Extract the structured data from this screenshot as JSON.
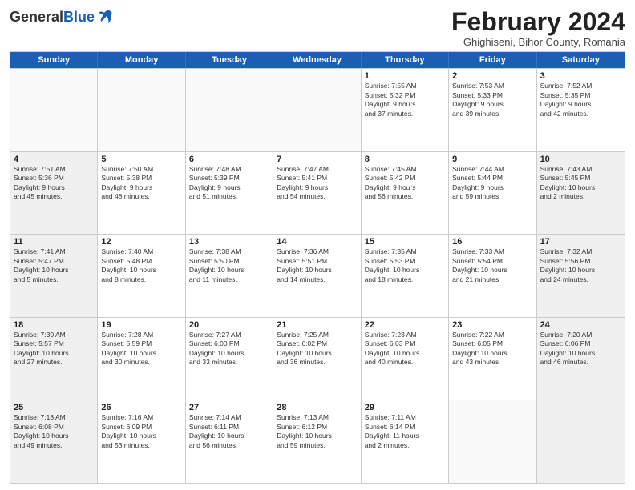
{
  "header": {
    "logo_general": "General",
    "logo_blue": "Blue",
    "month_title": "February 2024",
    "location": "Ghighiseni, Bihor County, Romania"
  },
  "days_of_week": [
    "Sunday",
    "Monday",
    "Tuesday",
    "Wednesday",
    "Thursday",
    "Friday",
    "Saturday"
  ],
  "rows": [
    [
      {
        "day": "",
        "empty": true,
        "lines": []
      },
      {
        "day": "",
        "empty": true,
        "lines": []
      },
      {
        "day": "",
        "empty": true,
        "lines": []
      },
      {
        "day": "",
        "empty": true,
        "lines": []
      },
      {
        "day": "1",
        "lines": [
          "Sunrise: 7:55 AM",
          "Sunset: 5:32 PM",
          "Daylight: 9 hours",
          "and 37 minutes."
        ]
      },
      {
        "day": "2",
        "lines": [
          "Sunrise: 7:53 AM",
          "Sunset: 5:33 PM",
          "Daylight: 9 hours",
          "and 39 minutes."
        ]
      },
      {
        "day": "3",
        "lines": [
          "Sunrise: 7:52 AM",
          "Sunset: 5:35 PM",
          "Daylight: 9 hours",
          "and 42 minutes."
        ]
      }
    ],
    [
      {
        "day": "4",
        "shaded": true,
        "lines": [
          "Sunrise: 7:51 AM",
          "Sunset: 5:36 PM",
          "Daylight: 9 hours",
          "and 45 minutes."
        ]
      },
      {
        "day": "5",
        "lines": [
          "Sunrise: 7:50 AM",
          "Sunset: 5:38 PM",
          "Daylight: 9 hours",
          "and 48 minutes."
        ]
      },
      {
        "day": "6",
        "lines": [
          "Sunrise: 7:48 AM",
          "Sunset: 5:39 PM",
          "Daylight: 9 hours",
          "and 51 minutes."
        ]
      },
      {
        "day": "7",
        "lines": [
          "Sunrise: 7:47 AM",
          "Sunset: 5:41 PM",
          "Daylight: 9 hours",
          "and 54 minutes."
        ]
      },
      {
        "day": "8",
        "lines": [
          "Sunrise: 7:45 AM",
          "Sunset: 5:42 PM",
          "Daylight: 9 hours",
          "and 56 minutes."
        ]
      },
      {
        "day": "9",
        "lines": [
          "Sunrise: 7:44 AM",
          "Sunset: 5:44 PM",
          "Daylight: 9 hours",
          "and 59 minutes."
        ]
      },
      {
        "day": "10",
        "shaded": true,
        "lines": [
          "Sunrise: 7:43 AM",
          "Sunset: 5:45 PM",
          "Daylight: 10 hours",
          "and 2 minutes."
        ]
      }
    ],
    [
      {
        "day": "11",
        "shaded": true,
        "lines": [
          "Sunrise: 7:41 AM",
          "Sunset: 5:47 PM",
          "Daylight: 10 hours",
          "and 5 minutes."
        ]
      },
      {
        "day": "12",
        "lines": [
          "Sunrise: 7:40 AM",
          "Sunset: 5:48 PM",
          "Daylight: 10 hours",
          "and 8 minutes."
        ]
      },
      {
        "day": "13",
        "lines": [
          "Sunrise: 7:38 AM",
          "Sunset: 5:50 PM",
          "Daylight: 10 hours",
          "and 11 minutes."
        ]
      },
      {
        "day": "14",
        "lines": [
          "Sunrise: 7:36 AM",
          "Sunset: 5:51 PM",
          "Daylight: 10 hours",
          "and 14 minutes."
        ]
      },
      {
        "day": "15",
        "lines": [
          "Sunrise: 7:35 AM",
          "Sunset: 5:53 PM",
          "Daylight: 10 hours",
          "and 18 minutes."
        ]
      },
      {
        "day": "16",
        "lines": [
          "Sunrise: 7:33 AM",
          "Sunset: 5:54 PM",
          "Daylight: 10 hours",
          "and 21 minutes."
        ]
      },
      {
        "day": "17",
        "shaded": true,
        "lines": [
          "Sunrise: 7:32 AM",
          "Sunset: 5:56 PM",
          "Daylight: 10 hours",
          "and 24 minutes."
        ]
      }
    ],
    [
      {
        "day": "18",
        "shaded": true,
        "lines": [
          "Sunrise: 7:30 AM",
          "Sunset: 5:57 PM",
          "Daylight: 10 hours",
          "and 27 minutes."
        ]
      },
      {
        "day": "19",
        "lines": [
          "Sunrise: 7:28 AM",
          "Sunset: 5:59 PM",
          "Daylight: 10 hours",
          "and 30 minutes."
        ]
      },
      {
        "day": "20",
        "lines": [
          "Sunrise: 7:27 AM",
          "Sunset: 6:00 PM",
          "Daylight: 10 hours",
          "and 33 minutes."
        ]
      },
      {
        "day": "21",
        "lines": [
          "Sunrise: 7:25 AM",
          "Sunset: 6:02 PM",
          "Daylight: 10 hours",
          "and 36 minutes."
        ]
      },
      {
        "day": "22",
        "lines": [
          "Sunrise: 7:23 AM",
          "Sunset: 6:03 PM",
          "Daylight: 10 hours",
          "and 40 minutes."
        ]
      },
      {
        "day": "23",
        "lines": [
          "Sunrise: 7:22 AM",
          "Sunset: 6:05 PM",
          "Daylight: 10 hours",
          "and 43 minutes."
        ]
      },
      {
        "day": "24",
        "shaded": true,
        "lines": [
          "Sunrise: 7:20 AM",
          "Sunset: 6:06 PM",
          "Daylight: 10 hours",
          "and 46 minutes."
        ]
      }
    ],
    [
      {
        "day": "25",
        "shaded": true,
        "lines": [
          "Sunrise: 7:18 AM",
          "Sunset: 6:08 PM",
          "Daylight: 10 hours",
          "and 49 minutes."
        ]
      },
      {
        "day": "26",
        "lines": [
          "Sunrise: 7:16 AM",
          "Sunset: 6:09 PM",
          "Daylight: 10 hours",
          "and 53 minutes."
        ]
      },
      {
        "day": "27",
        "lines": [
          "Sunrise: 7:14 AM",
          "Sunset: 6:11 PM",
          "Daylight: 10 hours",
          "and 56 minutes."
        ]
      },
      {
        "day": "28",
        "lines": [
          "Sunrise: 7:13 AM",
          "Sunset: 6:12 PM",
          "Daylight: 10 hours",
          "and 59 minutes."
        ]
      },
      {
        "day": "29",
        "lines": [
          "Sunrise: 7:11 AM",
          "Sunset: 6:14 PM",
          "Daylight: 11 hours",
          "and 2 minutes."
        ]
      },
      {
        "day": "",
        "empty": true,
        "lines": []
      },
      {
        "day": "",
        "empty": true,
        "shaded": true,
        "lines": []
      }
    ]
  ]
}
